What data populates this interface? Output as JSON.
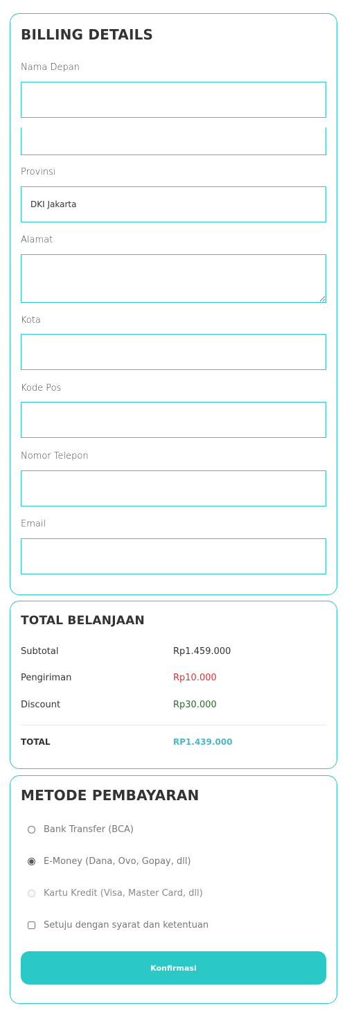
{
  "colors": {
    "accent": "#2bc8c8",
    "text": "#333333",
    "shipping": "#e0303a",
    "discount": "#2e6b2e",
    "total": "#4fb6c4",
    "button_text": "#ffffff"
  },
  "billing": {
    "title": "BILLING DETAILS",
    "fields": {
      "first_name_label": "Nama Depan",
      "first_name_value": "",
      "second_value": "",
      "province_label": "Provinsi",
      "province_value": "DKI Jakarta",
      "address_label": "Alamat",
      "address_value": "",
      "city_label": "Kota",
      "city_value": "",
      "postal_label": "Kode Pos",
      "postal_value": "",
      "phone_label": "Nomor Telepon",
      "phone_value": "",
      "email_label": "Email",
      "email_value": ""
    }
  },
  "summary": {
    "title": "TOTAL BELANJAAN",
    "subtotal_label": "Subtotal",
    "subtotal_value": "Rp1.459.000",
    "shipping_label": "Pengiriman",
    "shipping_value": "Rp10.000",
    "discount_label": "Discount",
    "discount_value": "Rp30.000",
    "total_label": "TOTAL",
    "total_value": "RP1.439.000"
  },
  "payment": {
    "title": "METODE PEMBAYARAN",
    "options": [
      {
        "label": "Bank Transfer (BCA)",
        "checked": false,
        "disabled": false
      },
      {
        "label": "E-Money (Dana, Ovo, Gopay, dll)",
        "checked": true,
        "disabled": false
      },
      {
        "label": "Kartu Kredit (Visa, Master Card, dll)",
        "checked": false,
        "disabled": true
      }
    ],
    "agree_label": "Setuju dengan syarat dan ketentuan",
    "agree_checked": false,
    "confirm_label": "Konfirmasi"
  }
}
